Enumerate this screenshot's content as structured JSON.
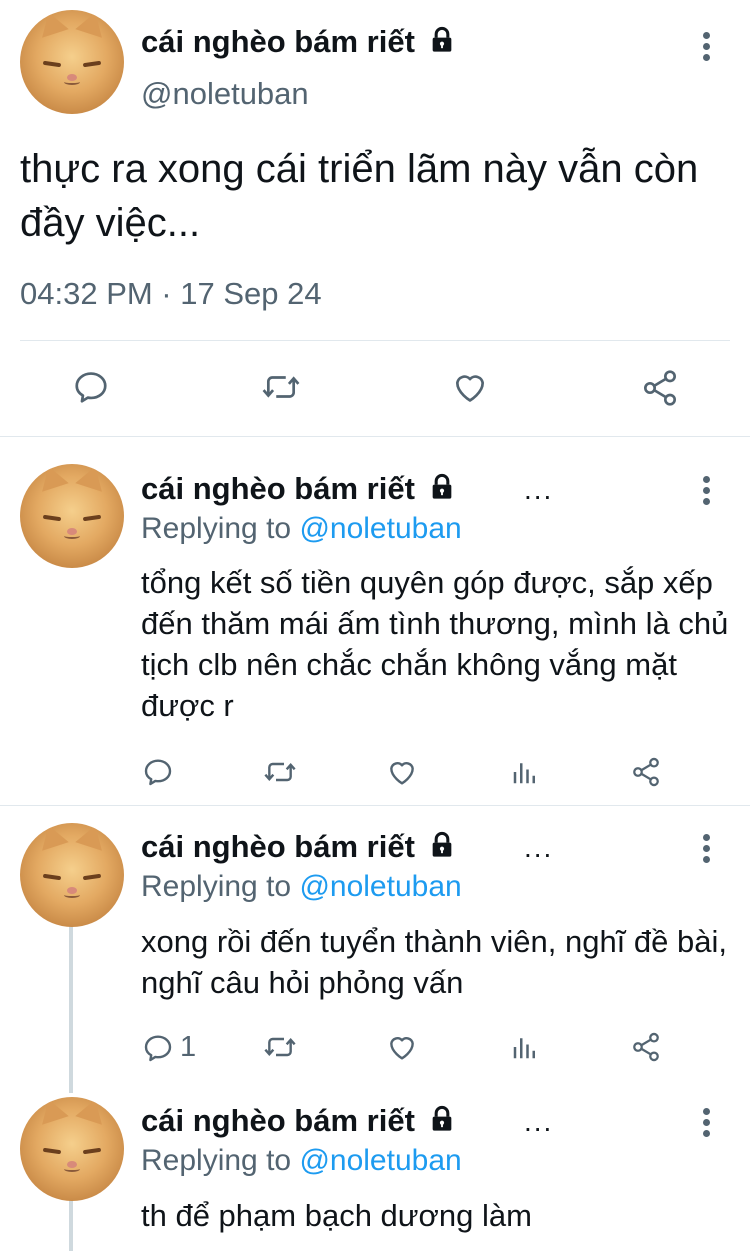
{
  "main_tweet": {
    "author_name": "cái nghèo bám riết",
    "handle": "@noletuban",
    "text": "thực ra xong cái triển lãm này vẫn còn đầy việc...",
    "timestamp": "04:32 PM · 17 Sep 24"
  },
  "replies": [
    {
      "author_name": "cái nghèo bám riết",
      "ellipsis": "...",
      "replying_prefix": "Replying to ",
      "replying_handle": "@noletuban",
      "text": "tổng kết số tiền quyên góp được, sắp xếp đến thăm mái ấm tình thương, mình là chủ tịch clb nên chắc chắn không vắng mặt được r",
      "reply_count": ""
    },
    {
      "author_name": "cái nghèo bám riết",
      "ellipsis": "...",
      "replying_prefix": "Replying to ",
      "replying_handle": "@noletuban",
      "text": "xong rồi đến tuyển thành viên, nghĩ đề bài, nghĩ câu hỏi phỏng vấn",
      "reply_count": "1"
    },
    {
      "author_name": "cái nghèo bám riết",
      "ellipsis": "...",
      "replying_prefix": "Replying to ",
      "replying_handle": "@noletuban",
      "text": "th để phạm bạch dương làm"
    }
  ],
  "icons": {
    "lock": "lock-icon",
    "more": "more-vertical-icon",
    "reply": "comment-icon",
    "retweet": "retweet-icon",
    "like": "heart-icon",
    "views": "bar-chart-icon",
    "share": "share-icon"
  },
  "colors": {
    "text": "#0f1419",
    "secondary": "#536471",
    "mention": "#1d9bf0",
    "divider": "#e1e8ed"
  }
}
